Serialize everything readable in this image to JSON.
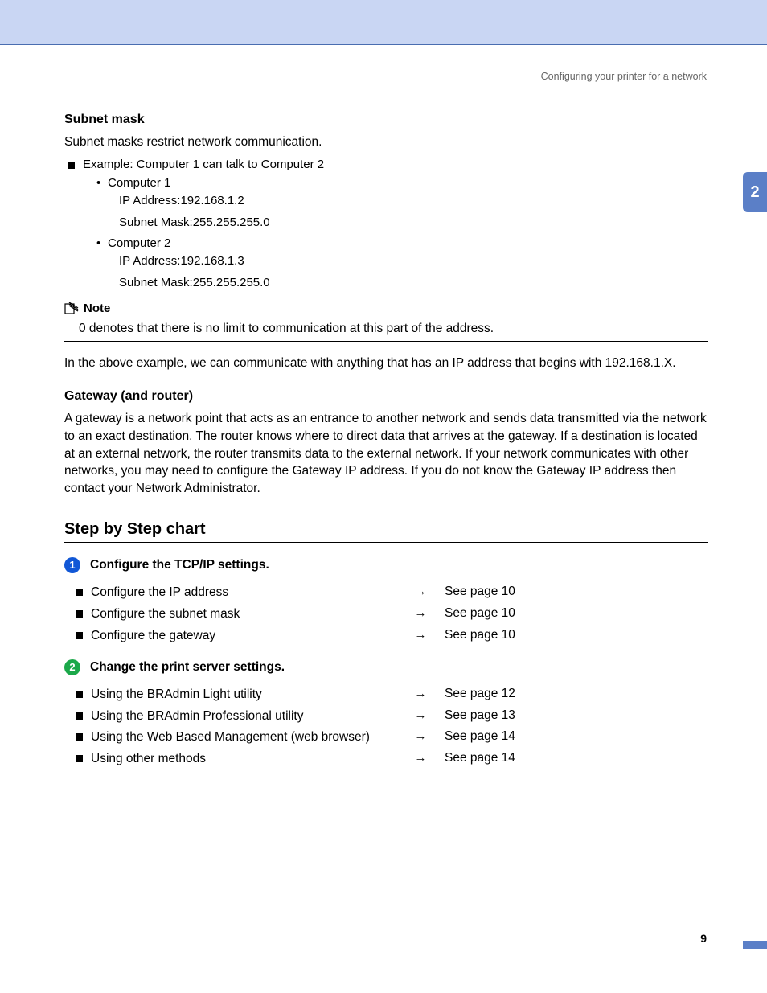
{
  "header": {
    "running_head": "Configuring your printer for a network",
    "chapter_tab": "2",
    "page_number": "9"
  },
  "subnet": {
    "title": "Subnet mask",
    "intro": "Subnet masks restrict network communication.",
    "example_label": "Example: Computer 1 can talk to Computer 2",
    "c1": {
      "name": "Computer 1",
      "ip_label": "IP Address:",
      "ip": "192.168.1.2",
      "mask_label": "Subnet Mask:",
      "mask": "255.255.255.0"
    },
    "c2": {
      "name": "Computer 2",
      "ip_label": "IP Address:",
      "ip": "192.168.1.3",
      "mask_label": "Subnet Mask:",
      "mask": "255.255.255.0"
    }
  },
  "note": {
    "label": "Note",
    "body": "0 denotes that there is no limit to communication at this part of the address."
  },
  "subnet_follow": "In the above example, we can communicate with anything that has an IP address that begins with 192.168.1.X.",
  "gateway": {
    "title": "Gateway (and router)",
    "body": "A gateway is a network point that acts as an entrance to another network and sends data transmitted via the network to an exact destination. The router knows where to direct data that arrives at the gateway. If a destination is located at an external network, the router transmits data to the external network. If your network communicates with other networks, you may need to configure the Gateway IP address. If you do not know the Gateway IP address then contact your Network Administrator."
  },
  "chart": {
    "title": "Step by Step chart",
    "step1": {
      "num": "1",
      "label": "Configure the TCP/IP settings.",
      "rows": [
        {
          "t": "Configure the IP address",
          "a": "→",
          "p": "See page 10"
        },
        {
          "t": "Configure the subnet mask",
          "a": "→",
          "p": "See page 10"
        },
        {
          "t": "Configure the gateway",
          "a": "→",
          "p": "See page 10"
        }
      ]
    },
    "step2": {
      "num": "2",
      "label": "Change the print server settings.",
      "rows": [
        {
          "t": "Using the BRAdmin Light utility",
          "a": "→",
          "p": "See page 12"
        },
        {
          "t": "Using the BRAdmin Professional utility",
          "a": "→",
          "p": "See page 13"
        },
        {
          "t": "Using the Web Based Management (web browser)",
          "a": "→",
          "p": "See page 14"
        },
        {
          "t": "Using other methods",
          "a": "→",
          "p": "See page 14"
        }
      ]
    }
  }
}
